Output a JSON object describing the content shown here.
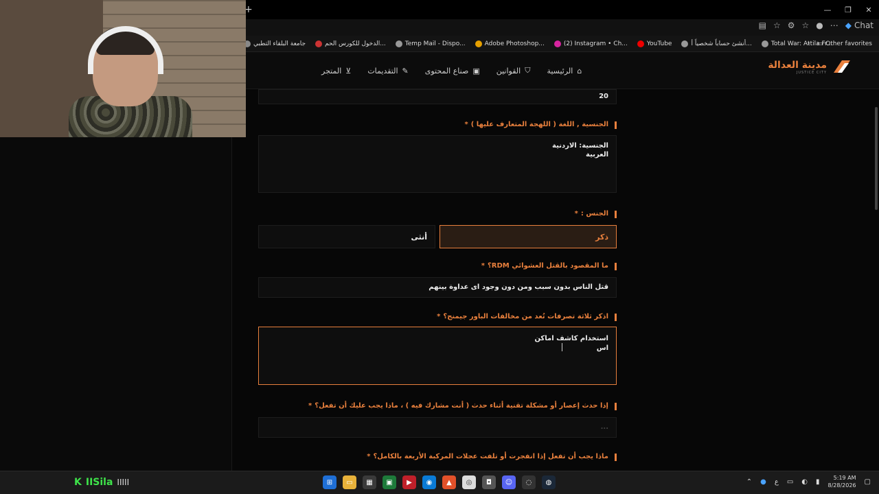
{
  "browser": {
    "new_tab": "+",
    "chat_label": "Chat",
    "window_controls": [
      "—",
      "❐",
      "✕"
    ],
    "bookmarks": [
      {
        "label": "جامعة البلقاء التطبي",
        "color": "#888"
      },
      {
        "label": "الدخول للكورس الحم...",
        "color": "#c33"
      },
      {
        "label": "Temp Mail - Dispo...",
        "color": "#999"
      },
      {
        "label": "Adobe Photoshop...",
        "color": "#e6a000"
      },
      {
        "label": "(2) Instagram • Ch...",
        "color": "#d6249f"
      },
      {
        "label": "YouTube",
        "color": "#e00"
      },
      {
        "label": "أنشئ حساباً شخصياً أ...",
        "color": "#999"
      },
      {
        "label": "Total War: Attila Fr...",
        "color": "#999"
      }
    ],
    "other_favorites": "Other favorites"
  },
  "site": {
    "logo_ar": "مدينة العدالة",
    "logo_en": "JUSTICE CITY",
    "nav": [
      {
        "label": "الرئيسية",
        "icon": "home-icon"
      },
      {
        "label": "القوانين",
        "icon": "shield-icon"
      },
      {
        "label": "صناع المحتوى",
        "icon": "video-icon"
      },
      {
        "label": "التقديمات",
        "icon": "edit-icon"
      },
      {
        "label": "المتجر",
        "icon": "cart-icon"
      }
    ]
  },
  "form": {
    "age_value": "20",
    "nationality_label": "الجنسية , اللغة ( اللهجة المتعارف عليها )",
    "nationality_line1": "الجنسية: الاردنية",
    "nationality_line2": "العربية",
    "gender_label": "الجنس :",
    "gender_male": "ذكر",
    "gender_female": "أنثى",
    "rdm_label": "ما المقصود بالقتل العشوائي RDM؟",
    "rdm_answer": "قتل الناس بدون سبب ومن دون وجود اى عداوة بينهم",
    "powergaming_label": "اذكر ثلاثة تصرفات تُعد من مخالفات الباور جيمنج؟",
    "powergaming_line1": "استخدام كاشف اماكن",
    "powergaming_line2": "اس",
    "crash_label": "إذا حدث إعصار أو مشكلة تقنية أثناء حدث ( أنت مشارك فيه ) ، ماذا يجب عليك أن تفعل؟",
    "crash_placeholder": "...",
    "tires_label": "ماذا يجب أن تفعل إذا انفجرت أو تلفت عجلات المركبة الأربعة بالكامل؟",
    "required_mark": "*"
  },
  "taskbar": {
    "brand_k": "K",
    "brand_name": "IISila",
    "brand_bars": "IIIII",
    "lang": "ع",
    "time": "5:19 AM",
    "date": "8/28/2026"
  }
}
